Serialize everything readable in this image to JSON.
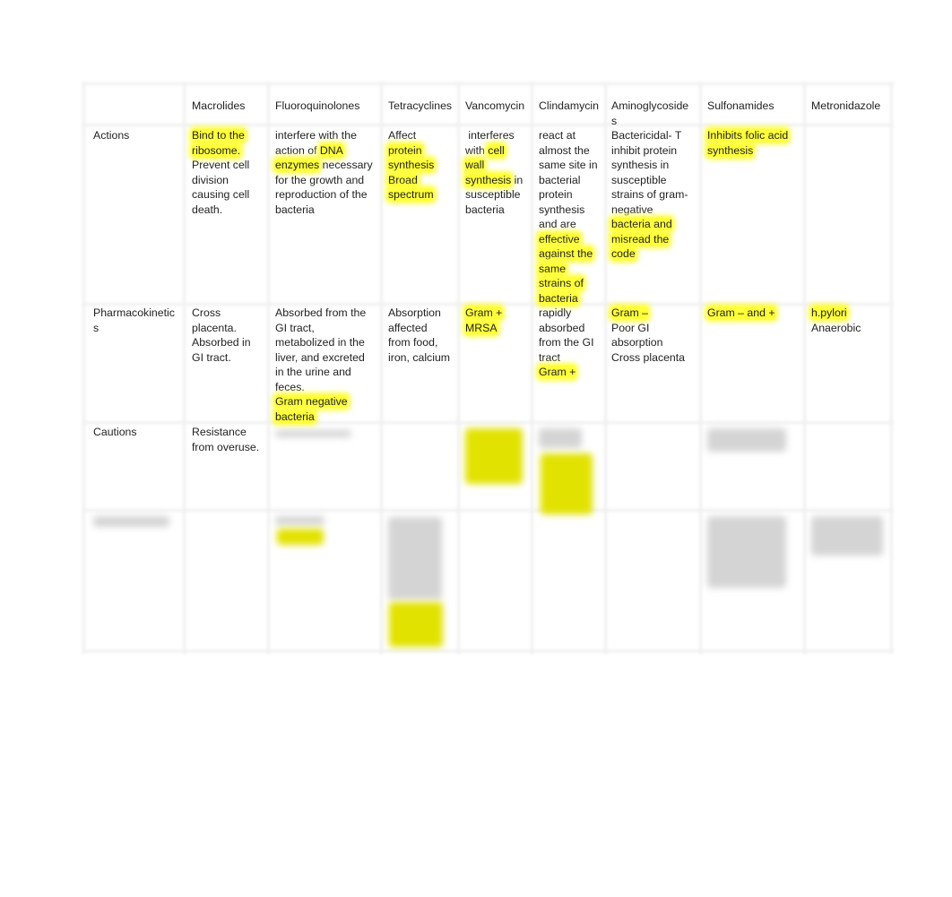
{
  "table": {
    "headers": [
      "",
      "Macrolides",
      "Fluoroquinolones",
      "Tetracyclines",
      "Vancomycin",
      "Clindamycin",
      [
        "Aminoglycoside",
        "s"
      ],
      "Sulfonamides",
      "Metronidazole"
    ],
    "row_labels": [
      [
        "Actions"
      ],
      [
        "Pharmacokinetic",
        "s"
      ],
      [
        "Cautions"
      ]
    ],
    "rows": [
      [
        [
          [
            [
              "Bind to the",
              true
            ]
          ],
          [
            [
              "ribosome.",
              true
            ]
          ],
          [
            [
              "Prevent cell",
              false
            ]
          ],
          [
            [
              "division",
              false
            ]
          ],
          [
            [
              "causing cell",
              false
            ]
          ],
          [
            [
              "death.",
              false
            ]
          ]
        ],
        [
          [
            [
              "interfere with the",
              false
            ]
          ],
          [
            [
              "action of ",
              false
            ],
            [
              "DNA",
              true
            ]
          ],
          [
            [
              "enzymes",
              true
            ],
            [
              " necessary",
              false
            ]
          ],
          [
            [
              "for the growth and",
              false
            ]
          ],
          [
            [
              "reproduction of the",
              false
            ]
          ],
          [
            [
              "bacteria",
              false
            ]
          ]
        ],
        [
          [
            [
              "Affect",
              false
            ]
          ],
          [
            [
              "protein",
              true
            ]
          ],
          [
            [
              "synthesis",
              true
            ]
          ],
          [
            [
              "Broad",
              true
            ]
          ],
          [
            [
              "spectrum",
              true
            ]
          ]
        ],
        [
          [
            [
              " interferes",
              false
            ]
          ],
          [
            [
              "with ",
              false
            ],
            [
              "cell",
              true
            ]
          ],
          [
            [
              "wall",
              true
            ]
          ],
          [
            [
              "synthesis",
              true
            ],
            [
              " in",
              false
            ]
          ],
          [
            [
              "susceptible",
              false
            ]
          ],
          [
            [
              "bacteria",
              false
            ]
          ]
        ],
        [
          [
            [
              "react at",
              false
            ]
          ],
          [
            [
              "almost the",
              false
            ]
          ],
          [
            [
              "same site in",
              false
            ]
          ],
          [
            [
              "bacterial",
              false
            ]
          ],
          [
            [
              "protein",
              false
            ]
          ],
          [
            [
              "synthesis",
              false
            ]
          ],
          [
            [
              "and are",
              false
            ]
          ],
          [
            [
              "effective",
              true
            ]
          ],
          [
            [
              "against the",
              true
            ]
          ],
          [
            [
              "same",
              true
            ]
          ],
          [
            [
              "strains of",
              true
            ]
          ],
          [
            [
              "bacteria",
              true
            ]
          ]
        ],
        [
          [
            [
              "Bactericidal- T",
              false
            ]
          ],
          [
            [
              "inhibit protein",
              false
            ]
          ],
          [
            [
              "synthesis in",
              false
            ]
          ],
          [
            [
              "susceptible",
              false
            ]
          ],
          [
            [
              "strains of gram-",
              false
            ]
          ],
          [
            [
              "negative",
              false
            ]
          ],
          [
            [
              "bacteria and",
              true
            ]
          ],
          [
            [
              "misread the",
              true
            ]
          ],
          [
            [
              "code",
              true
            ]
          ]
        ],
        [
          [
            [
              "Inhibits folic acid",
              true
            ]
          ],
          [
            [
              "synthesis",
              true
            ]
          ]
        ],
        []
      ],
      [
        [
          [
            [
              "Cross",
              false
            ]
          ],
          [
            [
              "placenta.",
              false
            ]
          ],
          [
            [
              "Absorbed in",
              false
            ]
          ],
          [
            [
              "GI tract.",
              false
            ]
          ]
        ],
        [
          [
            [
              "Absorbed from the",
              false
            ]
          ],
          [
            [
              "GI tract,",
              false
            ]
          ],
          [
            [
              "metabolized in the",
              false
            ]
          ],
          [
            [
              "liver, and excreted",
              false
            ]
          ],
          [
            [
              "in the urine and",
              false
            ]
          ],
          [
            [
              "feces.",
              false
            ]
          ],
          [
            [
              "Gram negative",
              true
            ]
          ],
          [
            [
              "bacteria",
              true
            ]
          ]
        ],
        [
          [
            [
              "Absorption",
              false
            ]
          ],
          [
            [
              "affected",
              false
            ]
          ],
          [
            [
              "from food,",
              false
            ]
          ],
          [
            [
              "iron, calcium",
              false
            ]
          ]
        ],
        [
          [
            [
              "Gram +",
              true
            ]
          ],
          [
            [
              "MRSA",
              true
            ]
          ]
        ],
        [
          [
            [
              "rapidly",
              false
            ]
          ],
          [
            [
              "absorbed",
              false
            ]
          ],
          [
            [
              "from the GI",
              false
            ]
          ],
          [
            [
              "tract",
              false
            ]
          ],
          [
            [
              "Gram +",
              true
            ]
          ]
        ],
        [
          [
            [
              "Gram –",
              true
            ]
          ],
          [
            [
              "Poor GI",
              false
            ]
          ],
          [
            [
              "absorption",
              false
            ]
          ],
          [
            [
              "Cross placenta",
              false
            ]
          ]
        ],
        [
          [
            [
              "Gram – and +",
              true
            ]
          ]
        ],
        [
          [
            [
              "h.pylori",
              true
            ]
          ],
          [
            [
              "Anaerobic",
              false
            ]
          ]
        ]
      ],
      [
        [
          [
            [
              "Resistance",
              false
            ]
          ],
          [
            [
              "from overuse.",
              false
            ]
          ]
        ],
        [],
        [],
        [],
        [],
        [],
        [],
        []
      ]
    ]
  },
  "colors": {
    "highlight": "#ffff3a",
    "border": "#f0f0f0"
  }
}
